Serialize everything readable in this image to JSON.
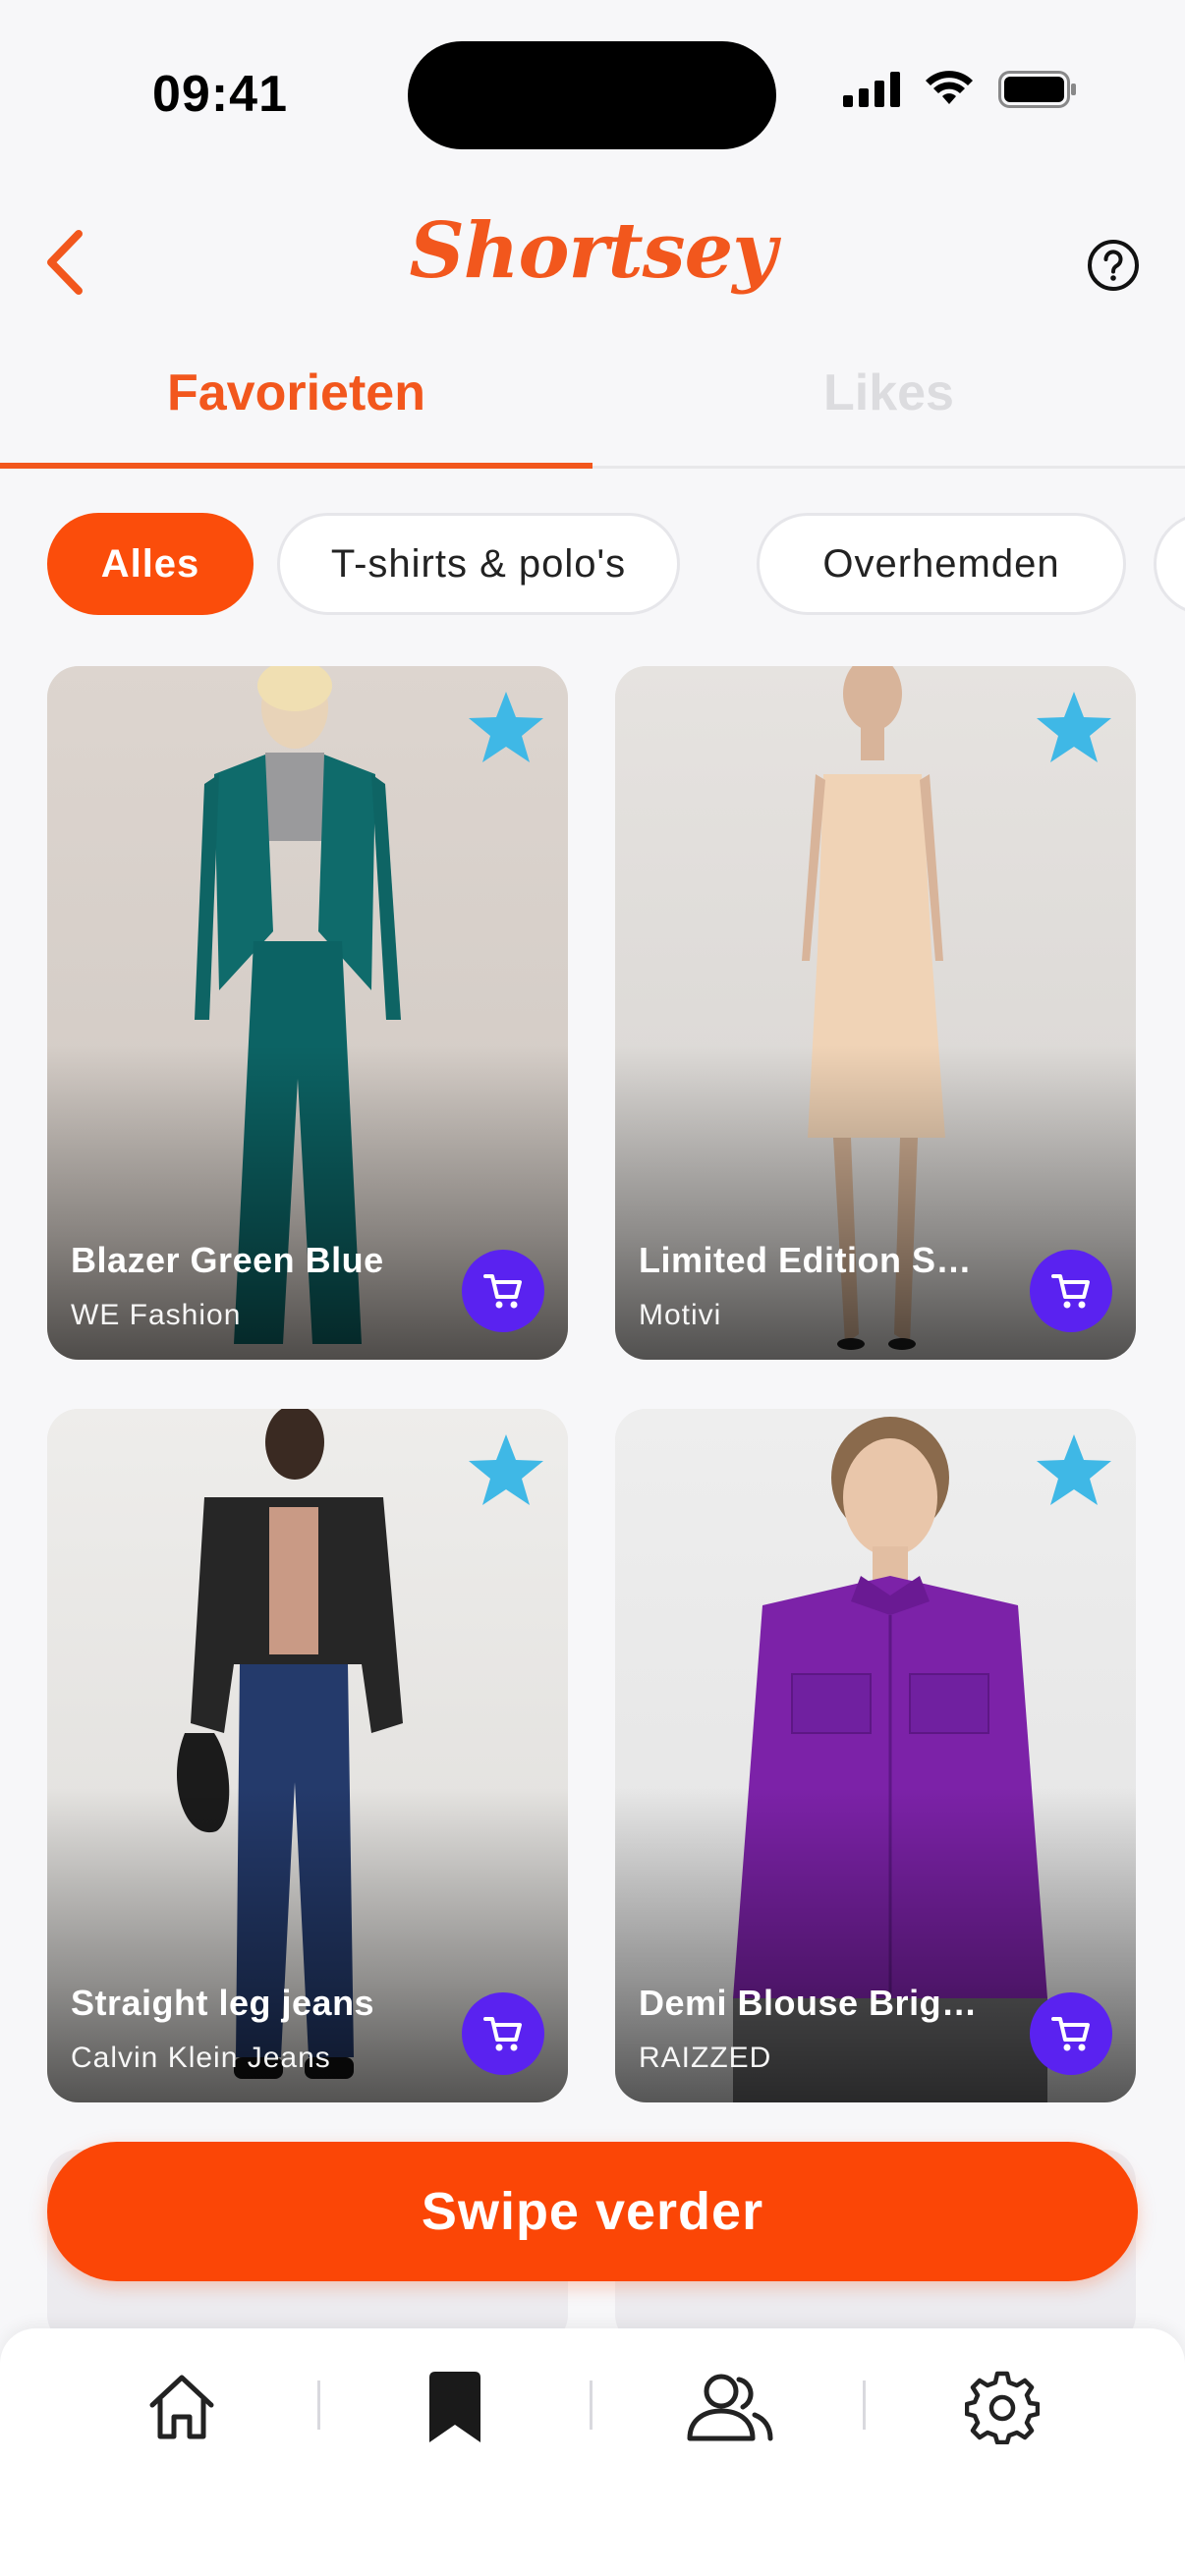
{
  "status_bar": {
    "time": "09:41"
  },
  "header": {
    "logo_text": "Shortsey",
    "back_icon": "chevron-left-icon",
    "help_icon": "help-circle-icon"
  },
  "tabs": [
    {
      "label": "Favorieten",
      "active": true
    },
    {
      "label": "Likes",
      "active": false
    }
  ],
  "filters": [
    {
      "label": "Alles",
      "active": true
    },
    {
      "label": "T-shirts & polo's",
      "active": false
    },
    {
      "label": "Overhemden",
      "active": false
    }
  ],
  "products": [
    {
      "name": "Blazer Green Blue",
      "brand": "WE Fashion"
    },
    {
      "name": "Limited Edition Sh...",
      "brand": "Motivi"
    },
    {
      "name": "Straight leg jeans",
      "brand": "Calvin Klein Jeans"
    },
    {
      "name": "Demi Blouse Brigh...",
      "brand": "RAIZZED"
    }
  ],
  "primary_button": {
    "label": "Swipe verder"
  },
  "bottom_nav": [
    {
      "icon": "home-icon"
    },
    {
      "icon": "bookmark-icon",
      "active": true
    },
    {
      "icon": "users-icon"
    },
    {
      "icon": "gear-icon"
    }
  ],
  "colors": {
    "accent": "#fb4d0b",
    "star": "#3fb8e6",
    "cart": "#5a22f0",
    "inactive_tab": "#dcdcdf"
  }
}
